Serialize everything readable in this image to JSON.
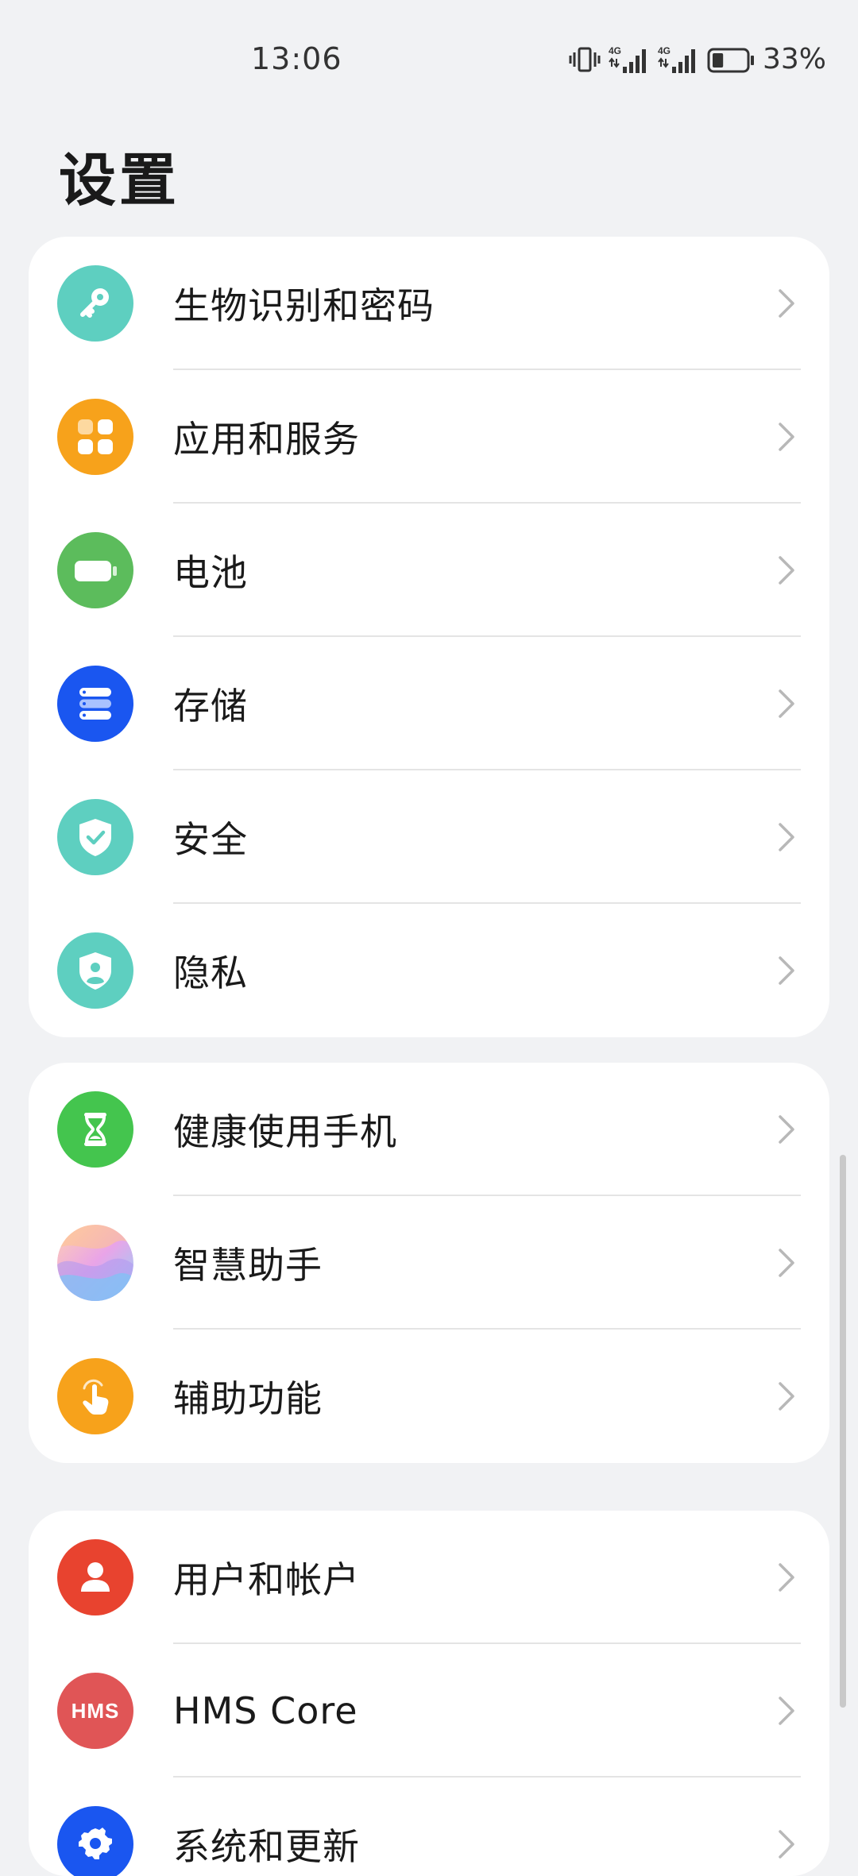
{
  "status_bar": {
    "time": "13:06",
    "network_1": "4G",
    "network_2": "4G",
    "battery_percent": "33%",
    "battery_level": 0.33
  },
  "page": {
    "title": "设置"
  },
  "groups": [
    {
      "items": [
        {
          "label": "生物识别和密码",
          "icon": "key-icon",
          "color": "#5ecfc0"
        },
        {
          "label": "应用和服务",
          "icon": "apps-icon",
          "color": "#f7a21b"
        },
        {
          "label": "电池",
          "icon": "battery-icon",
          "color": "#5cbc5c"
        },
        {
          "label": "存储",
          "icon": "storage-icon",
          "color": "#1a56f0"
        },
        {
          "label": "安全",
          "icon": "shield-check-icon",
          "color": "#5ecfc0"
        },
        {
          "label": "隐私",
          "icon": "privacy-shield-icon",
          "color": "#5ecfc0"
        }
      ]
    },
    {
      "items": [
        {
          "label": "健康使用手机",
          "icon": "hourglass-icon",
          "color": "#44c54e"
        },
        {
          "label": "智慧助手",
          "icon": "assistant-icon",
          "color": "#d8a4e8"
        },
        {
          "label": "辅助功能",
          "icon": "hand-tap-icon",
          "color": "#f7a21b"
        }
      ]
    },
    {
      "items": [
        {
          "label": "用户和帐户",
          "icon": "user-icon",
          "color": "#e8432f"
        },
        {
          "label": "HMS Core",
          "icon": "hms-icon",
          "icon_text": "HMS",
          "color": "#e05556"
        },
        {
          "label": "系统和更新",
          "icon": "gear-icon",
          "color": "#1a56f0"
        }
      ]
    }
  ]
}
